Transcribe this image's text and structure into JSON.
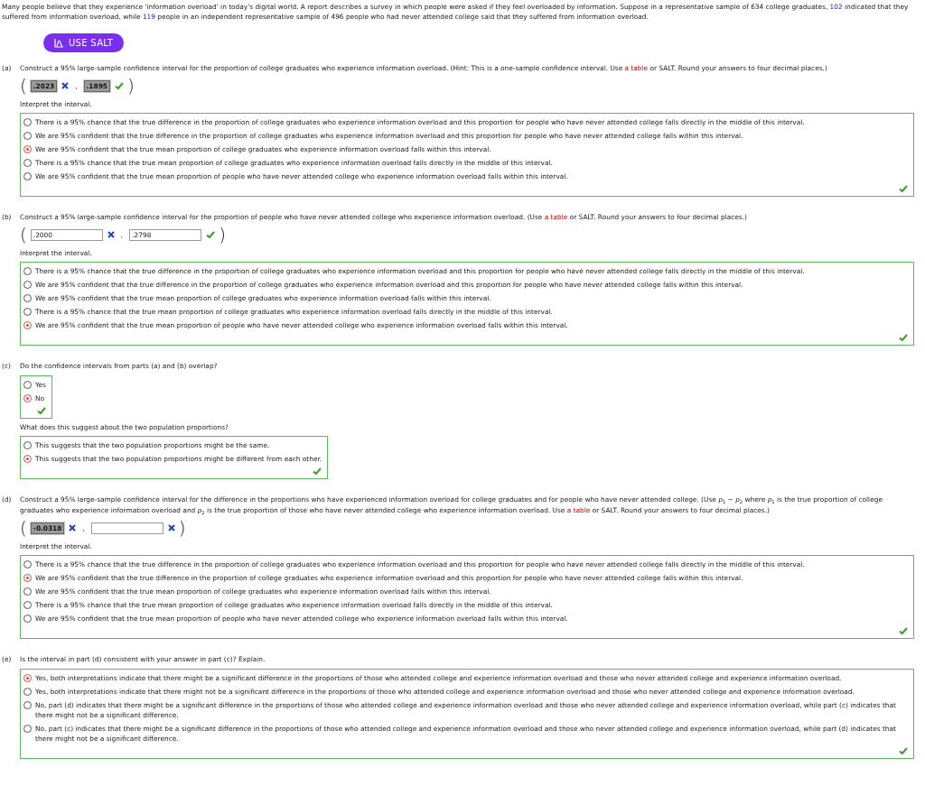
{
  "intro": [
    {
      "kind": "text",
      "text": "Many people believe that they experience 'information overload' in today's digital world. A report describes a survey in which people were asked if they feel overloaded by information. Suppose in a representative sample of 634 college graduates, "
    },
    {
      "kind": "value",
      "text": "102"
    },
    {
      "kind": "text",
      "text": " indicated that they suffered from information overload, while "
    },
    {
      "kind": "value",
      "text": "119"
    },
    {
      "kind": "text",
      "text": " people in an independent representative sample of 496 people who had never attended college said that they suffered from information overload."
    }
  ],
  "salt_button": {
    "label": "USE SALT"
  },
  "parts": [
    {
      "label": "(a)",
      "question": [
        {
          "kind": "text",
          "text": "Construct a 95% large-sample confidence interval for the proportion of college graduates who experience information overload. (Hint: This is a one-sample confidence interval. Use "
        },
        {
          "kind": "link",
          "text": "a table"
        },
        {
          "kind": "text",
          "text": " or SALT. Round your answers to four decimal places.)"
        }
      ],
      "interval": {
        "open": "(",
        "separator": ",",
        "close": ")",
        "fields": [
          {
            "kind": "shaded",
            "value": ".2023",
            "correct": false
          },
          {
            "kind": "shaded",
            "value": ".1895",
            "correct": true
          }
        ]
      },
      "groups": [
        {
          "kind": "full",
          "prompt": "Interpret the interval.",
          "correct": true,
          "options": [
            {
              "text": "There is a 95% chance that the true difference in the proportion of college graduates who experience information overload and this proportion for people who have never attended college falls directly in the middle of this interval.",
              "selected": false
            },
            {
              "text": "We are 95% confident that the true difference in the proportion of college graduates who experience information overload and this proportion for people who have never attended college falls within this interval.",
              "selected": false
            },
            {
              "text": "We are 95% confident that the true mean proportion of college graduates who experience information overload falls within this interval.",
              "selected": true
            },
            {
              "text": "There is a 95% chance that the true mean proportion of college graduates who experience information overload falls directly in the middle of this interval.",
              "selected": false
            },
            {
              "text": "We are 95% confident that the true mean proportion of people who have never attended college who experience information overload falls within this interval.",
              "selected": false
            }
          ]
        }
      ]
    },
    {
      "label": "(b)",
      "question": [
        {
          "kind": "text",
          "text": "Construct a 95% large-sample confidence interval for the proportion of people who have never attended college who experience information overload. (Use "
        },
        {
          "kind": "link",
          "text": "a table"
        },
        {
          "kind": "text",
          "text": " or SALT. Round your answers to four decimal places.)"
        }
      ],
      "interval": {
        "open": "(",
        "separator": ",",
        "close": ")",
        "fields": [
          {
            "kind": "input",
            "value": ".2000",
            "correct": false
          },
          {
            "kind": "input",
            "value": ".2798",
            "correct": true
          }
        ]
      },
      "groups": [
        {
          "kind": "full",
          "prompt": "Interpret the interval.",
          "correct": true,
          "options": [
            {
              "text": "There is a 95% chance that the true difference in the proportion of college graduates who experience information overload and this proportion for people who have never attended college falls directly in the middle of this interval.",
              "selected": false
            },
            {
              "text": "We are 95% confident that the true difference in the proportion of college graduates who experience information overload and this proportion for people who have never attended college falls within this interval.",
              "selected": false
            },
            {
              "text": "We are 95% confident that the true mean proportion of college graduates who experience information overload falls within this interval.",
              "selected": false
            },
            {
              "text": "There is a 95% chance that the true mean proportion of college graduates who experience information overload falls directly in the middle of this interval.",
              "selected": false
            },
            {
              "text": "We are 95% confident that the true mean proportion of people who have never attended college who experience information overload falls within this interval.",
              "selected": true
            }
          ]
        }
      ]
    },
    {
      "label": "(c)",
      "question": [
        {
          "kind": "text",
          "text": "Do the confidence intervals from parts (a) and (b) overlap?"
        }
      ],
      "groups": [
        {
          "kind": "fit",
          "correct": true,
          "options": [
            {
              "text": "Yes",
              "selected": false
            },
            {
              "text": "No",
              "selected": true
            }
          ]
        },
        {
          "kind": "fit",
          "prompt": "What does this suggest about the two population proportions?",
          "correct": true,
          "options": [
            {
              "text": "This suggests that the two population proportions might be the same.",
              "selected": false
            },
            {
              "text": "This suggests that the two population proportions might be different from each other.",
              "selected": true
            }
          ]
        }
      ]
    },
    {
      "label": "(d)",
      "question": [
        {
          "kind": "text",
          "text": "Construct a 95% large-sample confidence interval for the difference in the proportions who have experienced information overload for college graduates and for people who have never attended college. (Use *p*$_{1}$ − *p*$_{2}$ where *p*$_{1}$ is the true proportion of college graduates who experience information overload and *p*$_{2}$ is the true proportion of those who have never attended college who experience information overload. Use "
        },
        {
          "kind": "link",
          "text": "a table"
        },
        {
          "kind": "text",
          "text": " or SALT. Round your answers to four decimal places.)"
        }
      ],
      "interval": {
        "open": "(",
        "separator": ",",
        "close": ")",
        "fields": [
          {
            "kind": "shaded",
            "value": "-0.0318",
            "correct": false
          },
          {
            "kind": "input",
            "correct": false
          }
        ]
      },
      "groups": [
        {
          "kind": "full",
          "prompt": "Interpret the interval.",
          "correct": true,
          "options": [
            {
              "text": "There is a 95% chance that the true difference in the proportion of college graduates who experience information overload and this proportion for people who have never attended college falls directly in the middle of this interval.",
              "selected": false
            },
            {
              "text": "We are 95% confident that the true difference in the proportion of college graduates who experience information overload and this proportion for people who have never attended college falls within this interval.",
              "selected": true
            },
            {
              "text": "We are 95% confident that the true mean proportion of college graduates who experience information overload falls within this interval.",
              "selected": false
            },
            {
              "text": "There is a 95% chance that the true mean proportion of college graduates who experience information overload falls directly in the middle of this interval.",
              "selected": false
            },
            {
              "text": "We are 95% confident that the true mean proportion of people who have never attended college who experience information overload falls within this interval.",
              "selected": false
            }
          ]
        }
      ]
    },
    {
      "label": "(e)",
      "question": [
        {
          "kind": "text",
          "text": "Is the interval in part (d) consistent with your answer in part (c)? Explain."
        }
      ],
      "groups": [
        {
          "kind": "full",
          "correct": true,
          "options": [
            {
              "text": "Yes, both interpretations indicate that there might be a significant difference in the proportions of those who attended college and experience information overload and those who never attended college and experience information overload.",
              "selected": true
            },
            {
              "text": "Yes, both interpretations indicate that there might not be a significant difference in the proportions of those who attended college and experience information overload and those who never attended college and experience information overload.",
              "selected": false
            },
            {
              "text": "No, part (d) indicates that there might be a significant difference in the proportions of those who attended college and experience information overload and those who never attended college and experience information overload, while part (c) indicates that there might not be a significant difference.",
              "selected": false
            },
            {
              "text": "No, part (c) indicates that there might be a significant difference in the proportions of those who attended college and experience information overload and those who never attended college and experience information overload, while part (d) indicates that there might not be a significant difference.",
              "selected": false
            }
          ]
        }
      ]
    }
  ]
}
